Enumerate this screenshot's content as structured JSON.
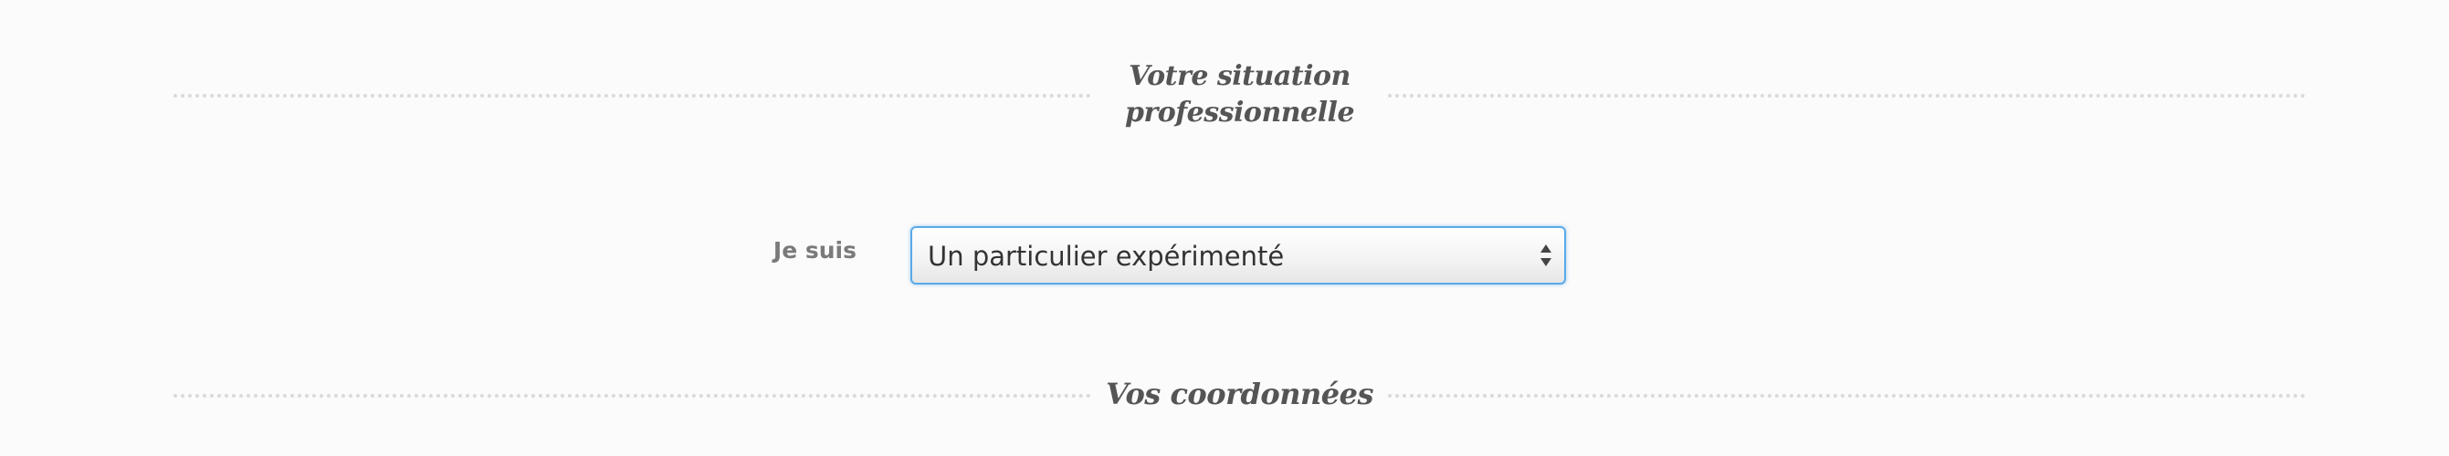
{
  "sections": {
    "professional_situation": {
      "title_line1": "Votre situation",
      "title_line2": "professionnelle"
    },
    "contact_details": {
      "title": "Vos coordonnées"
    }
  },
  "form": {
    "status_field": {
      "label": "Je suis",
      "selected_value": "Un particulier expérimenté",
      "icon": "select-arrows-icon"
    }
  },
  "colors": {
    "heading": "#555555",
    "label": "#7a7a7a",
    "focus_border": "#5aa9e6",
    "divider": "#dadada"
  }
}
